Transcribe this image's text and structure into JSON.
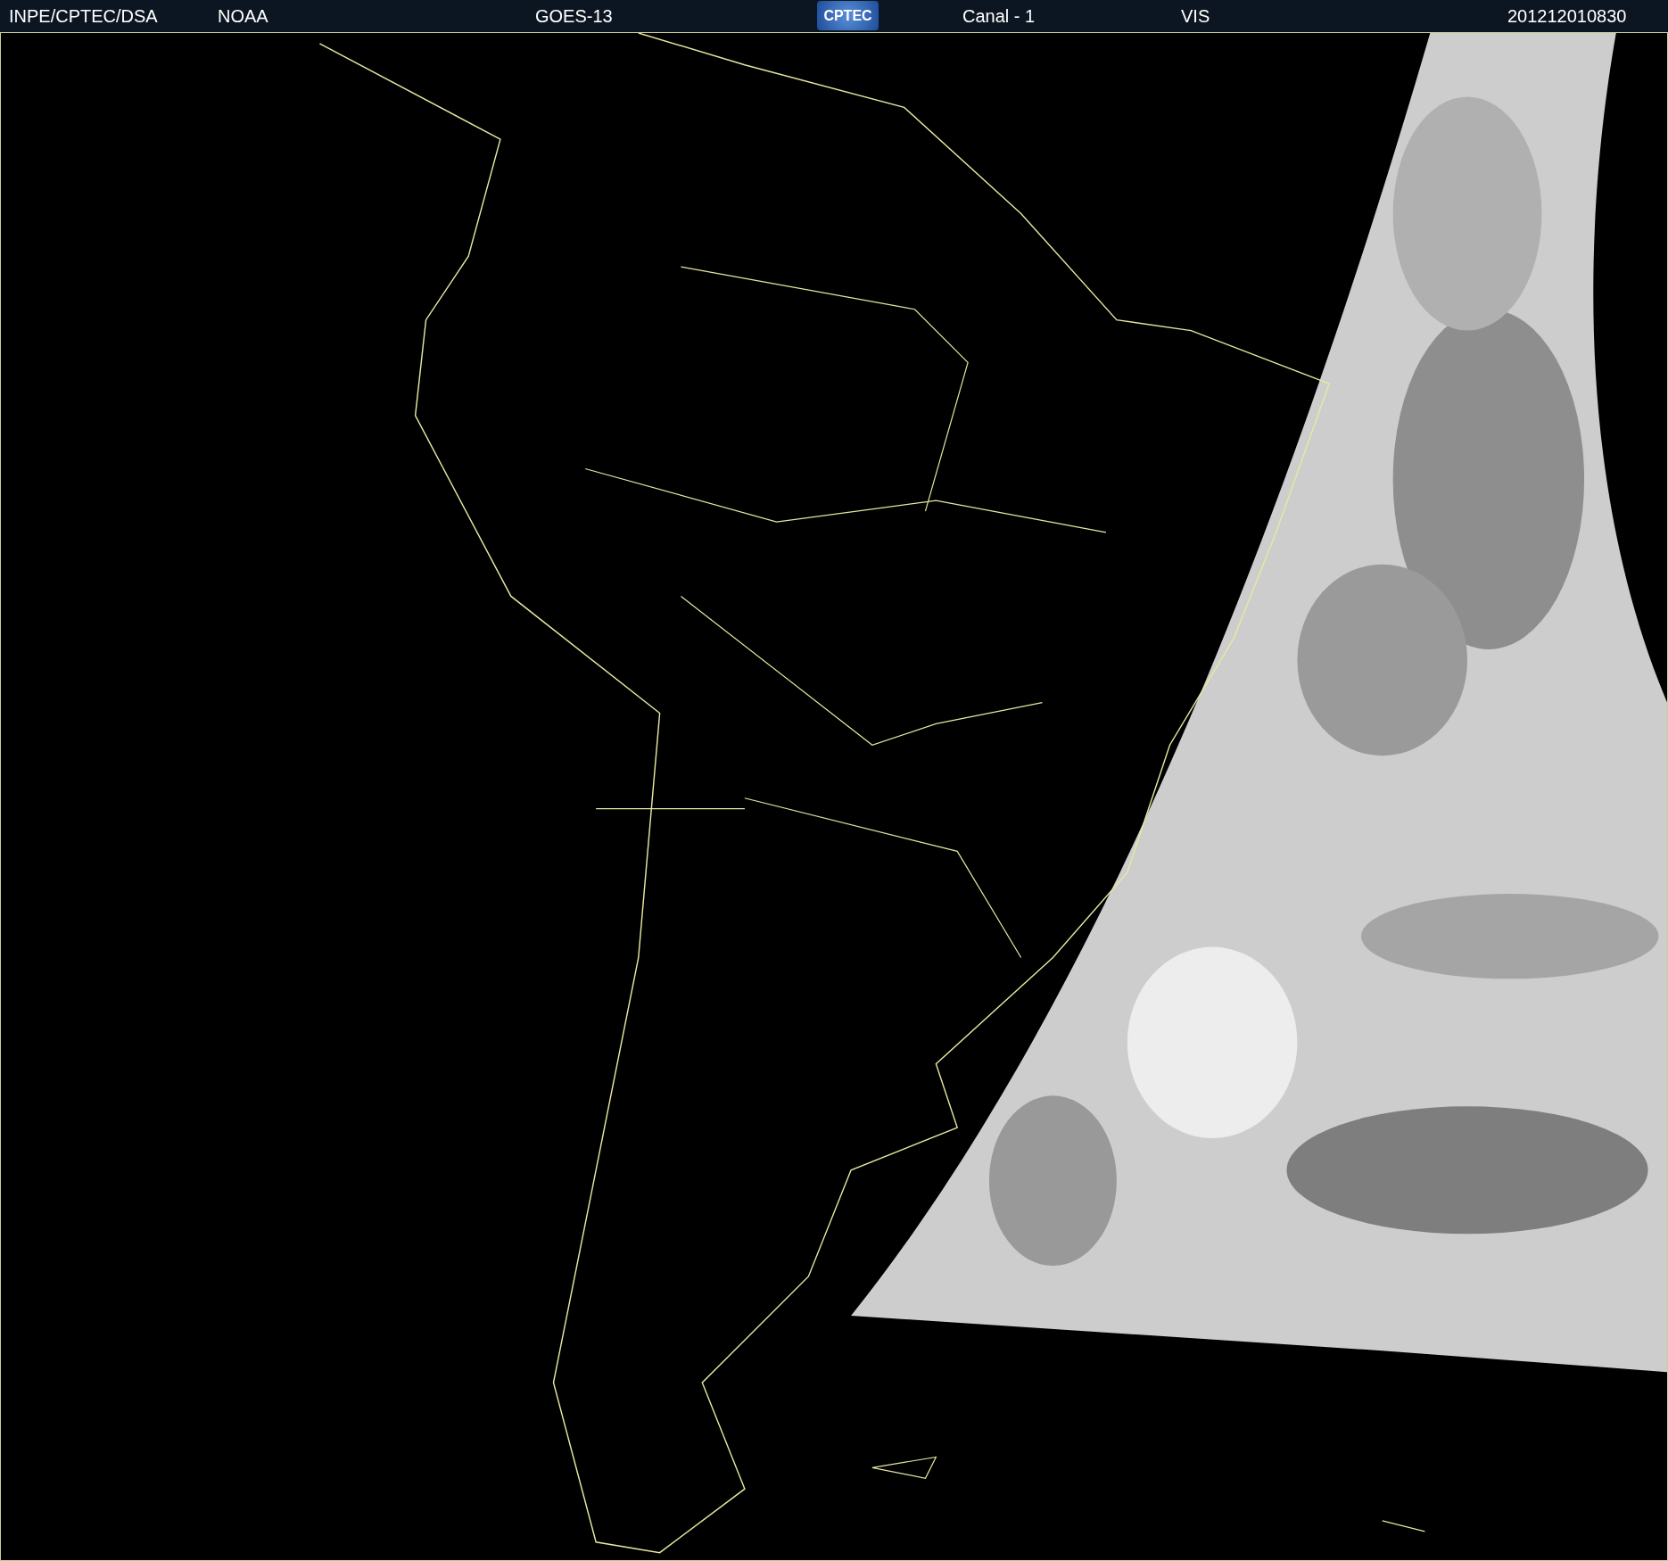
{
  "header": {
    "items": [
      {
        "kind": "text",
        "text": "INPE/CPTEC/DSA"
      },
      {
        "kind": "text",
        "text": "NOAA"
      },
      {
        "kind": "text",
        "text": "GOES-13"
      },
      {
        "kind": "logo",
        "text": "CPTEC"
      },
      {
        "kind": "text",
        "text": "Canal - 1"
      },
      {
        "kind": "text",
        "text": "VIS"
      },
      {
        "kind": "text",
        "text": "201212010830"
      }
    ]
  }
}
